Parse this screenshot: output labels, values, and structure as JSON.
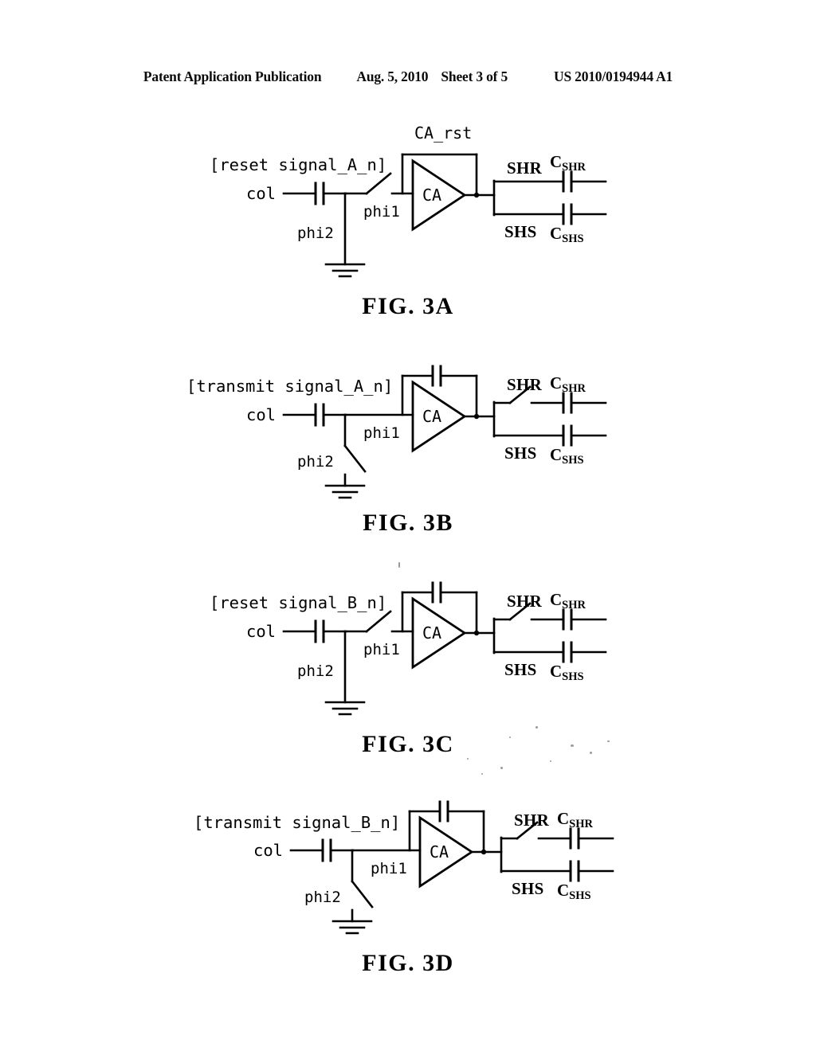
{
  "header": {
    "publication": "Patent Application Publication",
    "date": "Aug. 5, 2010",
    "sheet": "Sheet 3 of 5",
    "patent_number": "US 2010/0194944 A1"
  },
  "labels": {
    "col": "col",
    "phi1": "phi1",
    "phi2": "phi2",
    "ca": "CA",
    "ca_rst": "CA_rst",
    "shr": "SHR",
    "shs": "SHS",
    "c_main": "C",
    "c_shr_sub": "SHR",
    "c_shs_sub": "SHS"
  },
  "figures": [
    {
      "id": "fig-3a",
      "caption": "FIG. 3A",
      "signal_label": "[reset signal_A_n]",
      "feedback_label": "CA_rst",
      "feedback_type": "wire",
      "phi1_switch": "open",
      "phi2_switch": "closed",
      "shr_switch": "none",
      "shs_switch": "none"
    },
    {
      "id": "fig-3b",
      "caption": "FIG. 3B",
      "signal_label": "[transmit signal_A_n]",
      "feedback_label": "",
      "feedback_type": "capacitor",
      "phi1_switch": "closed",
      "phi2_switch": "open",
      "shr_switch": "open",
      "shs_switch": "none"
    },
    {
      "id": "fig-3c",
      "caption": "FIG. 3C",
      "signal_label": "[reset signal_B_n]",
      "feedback_label": "",
      "feedback_type": "capacitor",
      "phi1_switch": "open",
      "phi2_switch": "closed",
      "shr_switch": "open",
      "shs_switch": "none"
    },
    {
      "id": "fig-3d",
      "caption": "FIG. 3D",
      "signal_label": "[transmit signal_B_n]",
      "feedback_label": "",
      "feedback_type": "capacitor",
      "phi1_switch": "closed",
      "phi2_switch": "open",
      "shr_switch": "open",
      "shs_switch": "none"
    }
  ]
}
